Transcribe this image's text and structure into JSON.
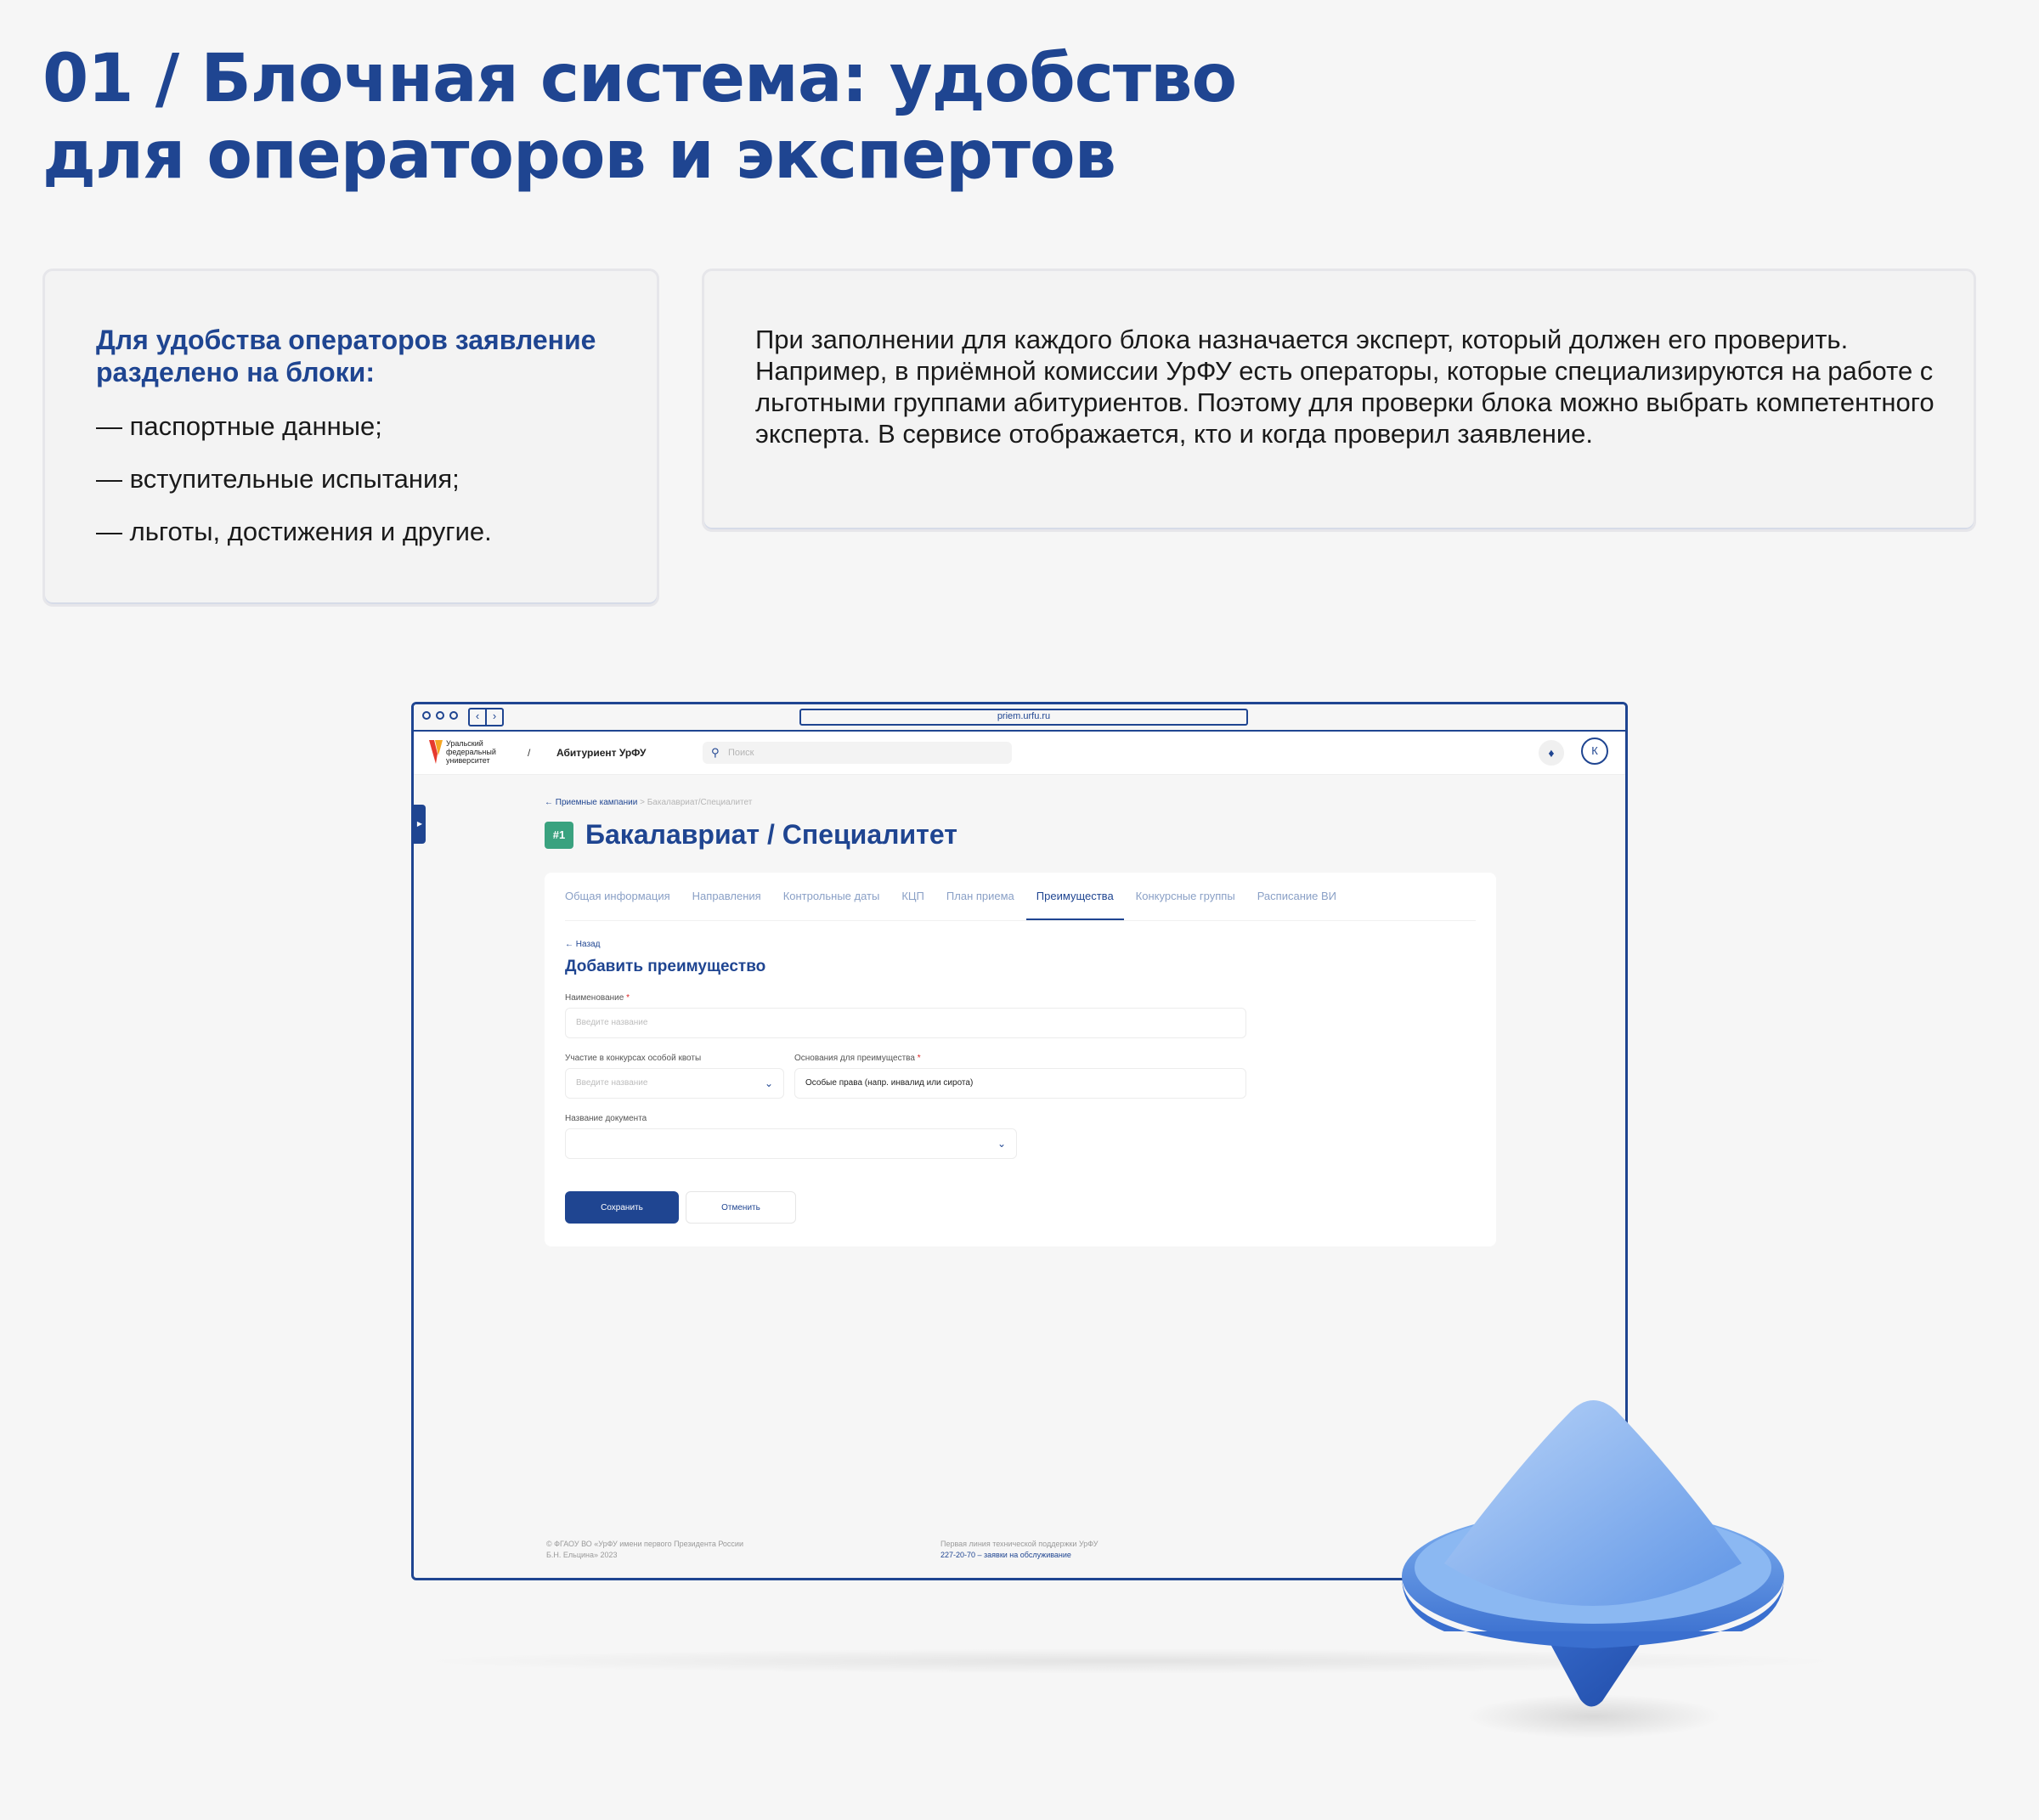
{
  "heading": {
    "line1": "01 / Блочная система: удобство",
    "line2": "для операторов и экспертов"
  },
  "card_left": {
    "lead": "Для удобства операторов заявление разделено на блоки:",
    "items": [
      "— паспортные данные;",
      "— вступительные испытания;",
      "— льготы, достижения и другие."
    ]
  },
  "card_right": {
    "text": "При заполнении для каждого блока назначается эксперт, который должен его проверить. Например, в приёмной комиссии УрФУ есть операторы, которые специализируются на работе с льготными группами абитуриентов. Поэтому для проверки блока можно выбрать компетентного эксперта. В сервисе отображается, кто и когда проверил заявление."
  },
  "browser": {
    "nav_back": "‹",
    "nav_forward": "›",
    "url": "priem.urfu.ru"
  },
  "app": {
    "logo_text": "Уральский федеральный университет",
    "crumb_separator": "/",
    "app_name": "Абитуриент УрФУ",
    "search_placeholder": "Поиск",
    "avatar_letter": "К"
  },
  "page": {
    "breadcrumb_link": "← Приемные кампании",
    "breadcrumb_sep": ">",
    "breadcrumb_current": "Бакалавриат/Специалитет",
    "badge": "#1",
    "title": "Бакалавриат / Специалитет",
    "tabs": [
      "Общая информация",
      "Направления",
      "Контрольные даты",
      "КЦП",
      "План приема",
      "Преимущества",
      "Конкурсные группы",
      "Расписание ВИ"
    ],
    "active_tab": 5
  },
  "form": {
    "back": "← Назад",
    "title": "Добавить преимущество",
    "name_label": "Наименование",
    "name_placeholder": "Введите название",
    "quota_label": "Участие в конкурсах особой квоты",
    "quota_placeholder": "Введите название",
    "basis_label": "Основания для преимущества",
    "basis_value": "Особые права (напр. инвалид или сирота)",
    "doc_label": "Название документа",
    "doc_value": "",
    "required_mark": "*",
    "save": "Сохранить",
    "cancel": "Отменить"
  },
  "footer": {
    "left_line1": "© ФГАОУ ВО «УрФУ имени первого Президента России",
    "left_line2": "Б.Н. Ельцина» 2023",
    "right_line1": "Первая линия технической поддержки УрФУ",
    "right_line2": "227-20-70 – заявки на обслуживание"
  },
  "colors": {
    "brand_blue": "#1f4591",
    "badge_green": "#3aa27f",
    "spinner_light": "#7fb0f0",
    "spinner_dark": "#2f5fbf"
  }
}
